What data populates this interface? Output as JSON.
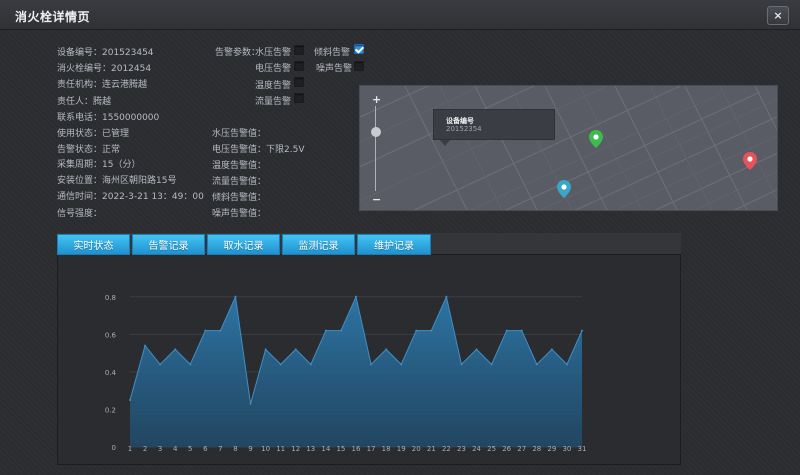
{
  "window": {
    "title": "消火栓详情页",
    "close_label": "×"
  },
  "info": {
    "left": [
      "设备编号：201523454",
      "消火栓编号：2012454",
      "责任机构：连云港腾越",
      "责任人：腾越",
      "联系电话：1550000000",
      "使用状态：已管理",
      "告警状态：正常",
      "采集周期：15（分）",
      "安装位置：海州区朝阳路15号",
      "通信时间：2022-3-21 13：49：00",
      "信号强度："
    ],
    "alarm_params_label": "告警参数：",
    "alarm_checks": [
      {
        "label": "水压告警",
        "checked": false
      },
      {
        "label": "电压告警",
        "checked": false
      },
      {
        "label": "温度告警",
        "checked": false
      },
      {
        "label": "流量告警",
        "checked": false
      },
      {
        "label": "倾斜告警",
        "checked": true
      },
      {
        "label": "噪声告警",
        "checked": false
      }
    ],
    "thresholds": [
      "水压告警值：",
      "电压告警值：下限2.5V",
      "温度告警值：",
      "流量告警值：",
      "倾斜告警值：",
      "噪声告警值："
    ]
  },
  "map": {
    "zoom_in": "+",
    "zoom_out": "−",
    "tooltip_title": "设备编号",
    "tooltip_value": "20152354",
    "pins": [
      {
        "name": "green",
        "color": "#3cbc4e"
      },
      {
        "name": "teal",
        "color": "#3aa7c9"
      },
      {
        "name": "red",
        "color": "#e8525a"
      }
    ]
  },
  "tabs": [
    "实时状态",
    "告警记录",
    "取水记录",
    "监测记录",
    "维护记录"
  ],
  "chart_data": {
    "type": "area",
    "categories": [
      "1",
      "2",
      "3",
      "4",
      "5",
      "6",
      "7",
      "8",
      "9",
      "10",
      "11",
      "12",
      "13",
      "14",
      "15",
      "16",
      "17",
      "18",
      "19",
      "20",
      "21",
      "22",
      "23",
      "24",
      "25",
      "26",
      "27",
      "28",
      "29",
      "30",
      "31"
    ],
    "values": [
      0.25,
      0.54,
      0.44,
      0.52,
      0.44,
      0.62,
      0.62,
      0.8,
      0.23,
      0.52,
      0.44,
      0.52,
      0.44,
      0.62,
      0.62,
      0.8,
      0.44,
      0.52,
      0.44,
      0.62,
      0.62,
      0.8,
      0.44,
      0.52,
      0.44,
      0.62,
      0.62,
      0.44,
      0.52,
      0.44,
      0.62
    ],
    "y_ticks": [
      "0",
      "0.2",
      "0.4",
      "0.6",
      "0.8"
    ],
    "ylim": [
      0,
      0.9
    ],
    "fill_color": "#2a6f9e",
    "line_color": "#3f8fc4",
    "grid": true
  }
}
